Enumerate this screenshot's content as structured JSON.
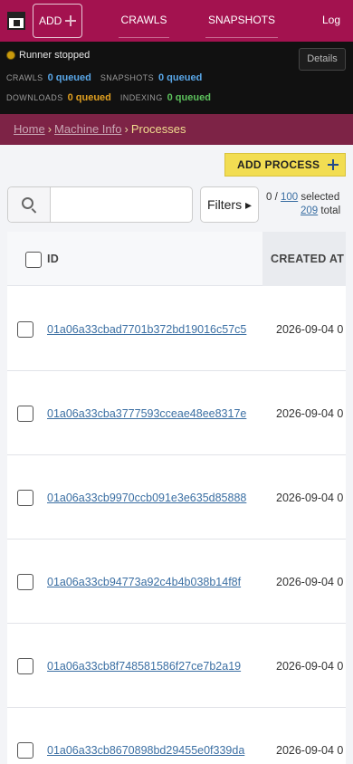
{
  "nav": {
    "add_label": "ADD",
    "crawls_label": "CRAWLS",
    "snapshots_label": "SNAPSHOTS",
    "logout_label": "Log out"
  },
  "status": {
    "runner_text": "Runner stopped",
    "details_label": "Details",
    "crawls_label": "CRAWLS",
    "crawls_value": "0 queued",
    "snapshots_label": "SNAPSHOTS",
    "snapshots_value": "0 queued",
    "downloads_label": "DOWNLOADS",
    "downloads_value": "0 queued",
    "indexing_label": "INDEXING",
    "indexing_value": "0 queued"
  },
  "breadcrumb": {
    "home": "Home",
    "machine_info": "Machine Info",
    "current": "Processes",
    "separator": "›"
  },
  "actions": {
    "add_process_label": "ADD PROCESS"
  },
  "search": {
    "placeholder": "",
    "value": ""
  },
  "filters": {
    "label": "Filters ▸"
  },
  "selection": {
    "selected_count": "0",
    "page_size": "100",
    "selected_suffix": "selected",
    "total": "209",
    "total_suffix": "total"
  },
  "table": {
    "columns": [
      "ID",
      "CREATED AT"
    ],
    "rows": [
      {
        "id": "01a06a33cbad7701b372bd19016c57c5",
        "created": "2026-09-04 0"
      },
      {
        "id": "01a06a33cba3777593cceae48ee8317e",
        "created": "2026-09-04 0"
      },
      {
        "id": "01a06a33cb9970ccb091e3e635d85888",
        "created": "2026-09-04 0"
      },
      {
        "id": "01a06a33cb94773a92c4b4b038b14f8f",
        "created": "2026-09-04 0"
      },
      {
        "id": "01a06a33cb8f748581586f27ce7b2a19",
        "created": "2026-09-04 0"
      },
      {
        "id": "01a06a33cb8670898bd29455e0f339da",
        "created": "2026-09-04 0"
      }
    ]
  },
  "colors": {
    "nav_bg": "#a3124f",
    "status_bg": "#111111",
    "breadcrumb_bg": "#7d2346",
    "add_process_bg": "#f2dd52",
    "link": "#3b6fa3"
  }
}
